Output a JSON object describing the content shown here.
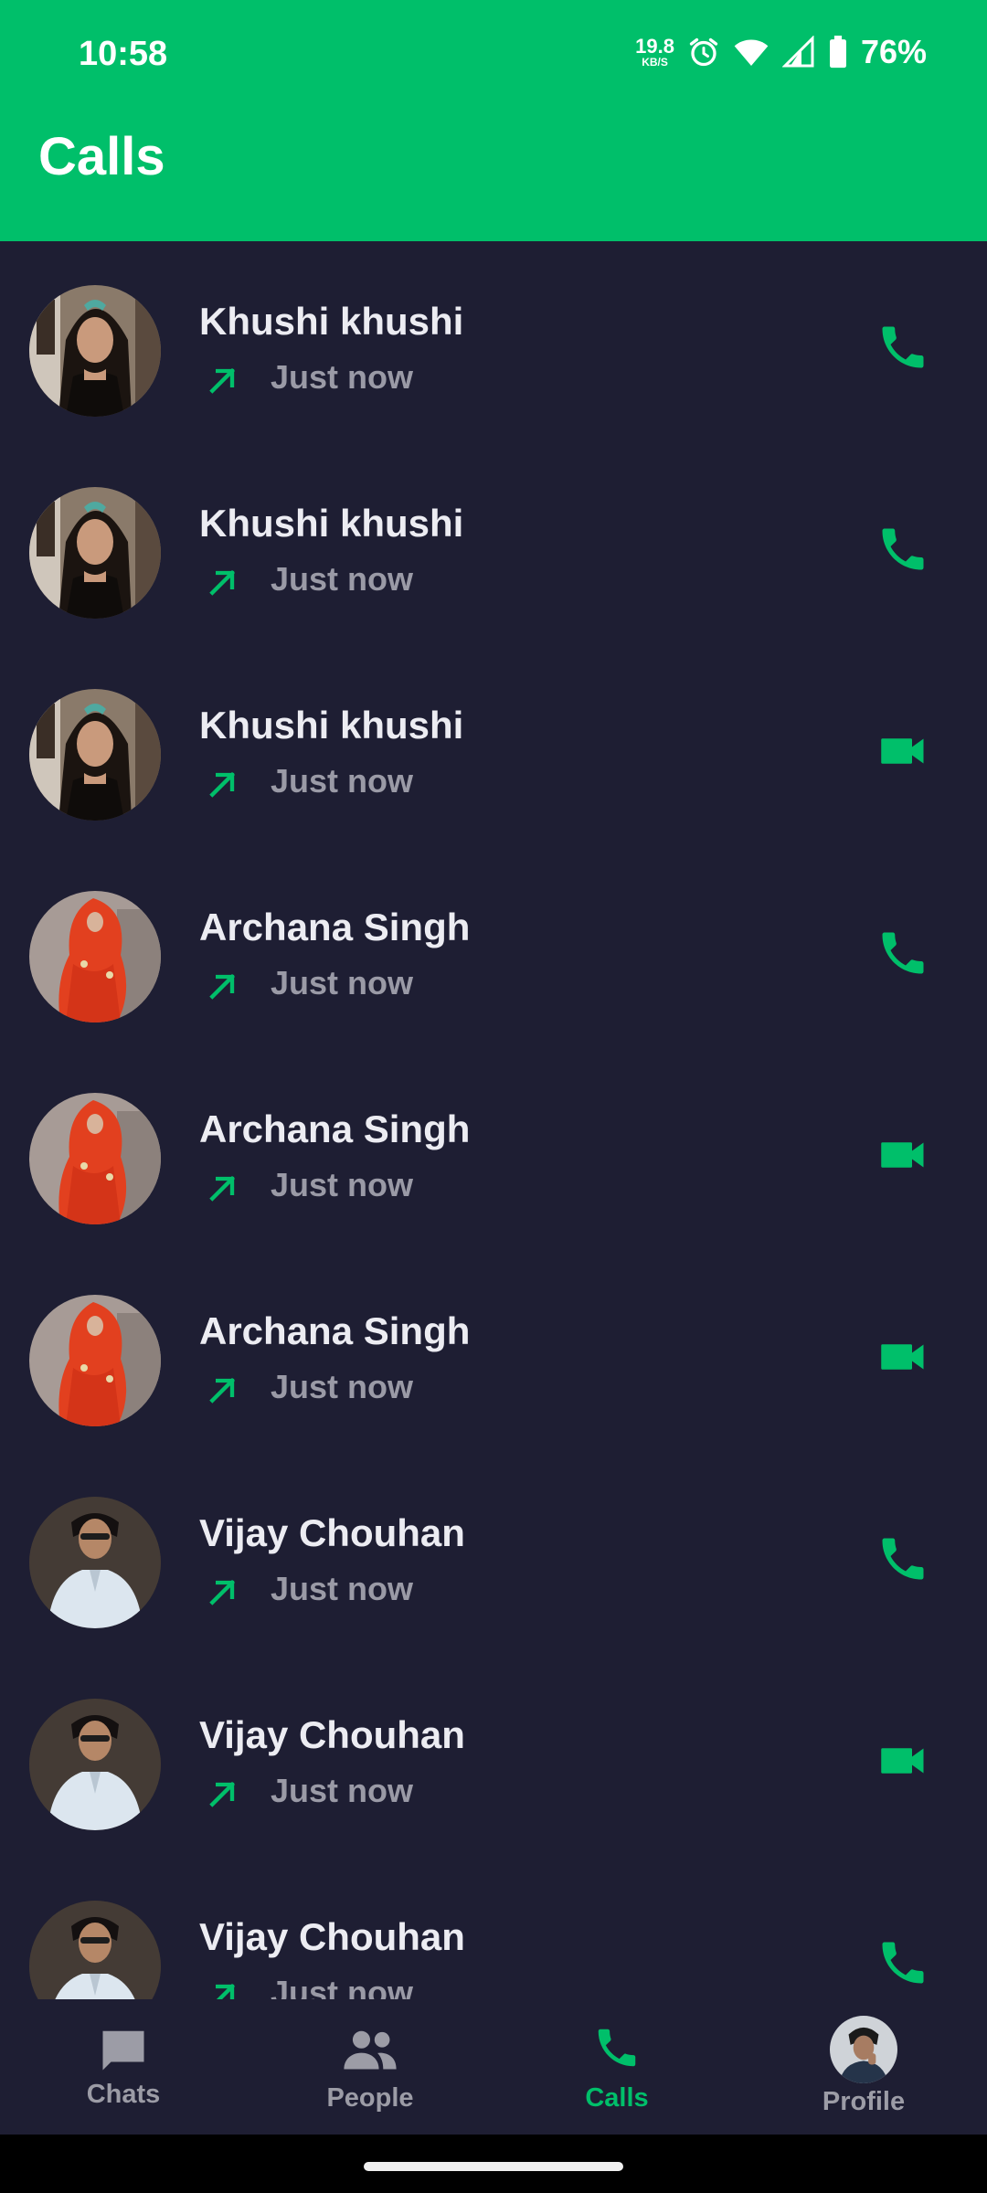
{
  "status_bar": {
    "time": "10:58",
    "net_speed": "19.8",
    "net_unit": "KB/S",
    "battery": "76%"
  },
  "header": {
    "title": "Calls"
  },
  "calls": [
    {
      "name": "Khushi khushi",
      "time": "Just now",
      "direction": "outgoing",
      "type": "voice",
      "avatar": "khushi"
    },
    {
      "name": "Khushi khushi",
      "time": "Just now",
      "direction": "outgoing",
      "type": "voice",
      "avatar": "khushi"
    },
    {
      "name": "Khushi khushi",
      "time": "Just now",
      "direction": "outgoing",
      "type": "video",
      "avatar": "khushi"
    },
    {
      "name": "Archana Singh",
      "time": "Just now",
      "direction": "outgoing",
      "type": "voice",
      "avatar": "archana"
    },
    {
      "name": "Archana Singh",
      "time": "Just now",
      "direction": "outgoing",
      "type": "video",
      "avatar": "archana"
    },
    {
      "name": "Archana Singh",
      "time": "Just now",
      "direction": "outgoing",
      "type": "video",
      "avatar": "archana"
    },
    {
      "name": "Vijay Chouhan",
      "time": "Just now",
      "direction": "outgoing",
      "type": "voice",
      "avatar": "vijay"
    },
    {
      "name": "Vijay Chouhan",
      "time": "Just now",
      "direction": "outgoing",
      "type": "video",
      "avatar": "vijay"
    },
    {
      "name": "Vijay Chouhan",
      "time": "Just now",
      "direction": "outgoing",
      "type": "voice",
      "avatar": "vijay"
    }
  ],
  "nav": [
    {
      "label": "Chats",
      "icon": "chat-icon",
      "active": false
    },
    {
      "label": "People",
      "icon": "people-icon",
      "active": false
    },
    {
      "label": "Calls",
      "icon": "phone-icon",
      "active": true
    },
    {
      "label": "Profile",
      "icon": "avatar",
      "active": false
    }
  ],
  "colors": {
    "accent": "#00bf6a",
    "background": "#1e1e33",
    "name_text": "#ececf2",
    "muted_text": "#9a9aa6"
  }
}
